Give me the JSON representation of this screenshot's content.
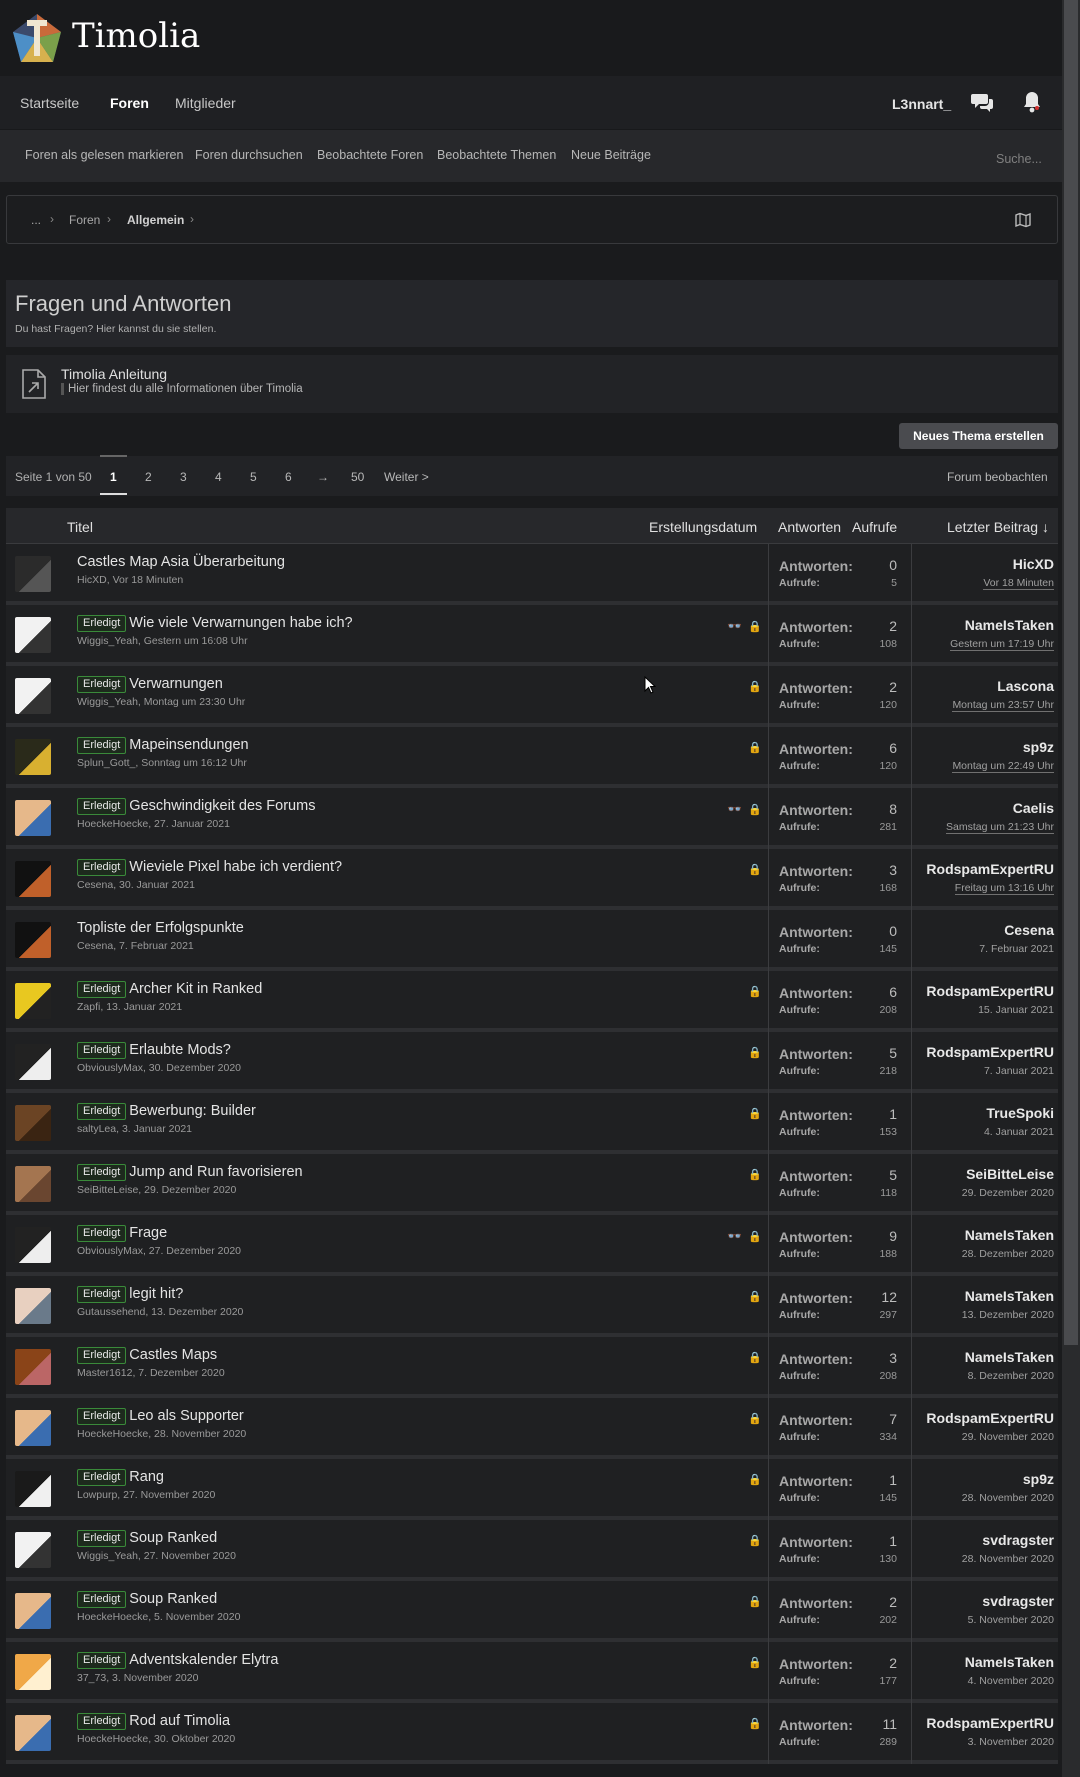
{
  "site": {
    "title": "Timolia"
  },
  "nav": {
    "items": [
      "Startseite",
      "Foren",
      "Mitglieder"
    ],
    "active": "Foren",
    "user": "L3nnart_"
  },
  "subnav": {
    "items": [
      "Foren als gelesen markieren",
      "Foren durchsuchen",
      "Beobachtete Foren",
      "Beobachtete Themen",
      "Neue Beiträge"
    ],
    "search_placeholder": "Suche..."
  },
  "breadcrumb": {
    "items": [
      "...",
      "Foren",
      "Allgemein"
    ],
    "sep": "›"
  },
  "forum": {
    "title": "Fragen und Antworten",
    "description": "Du hast Fragen? Hier kannst du sie stellen."
  },
  "linkbox": {
    "title": "Timolia Anleitung",
    "description": "Hier findest du alle Informationen über Timolia"
  },
  "new_thread_button": "Neues Thema erstellen",
  "pager": {
    "label": "Seite 1 von 50",
    "pages": [
      "1",
      "2",
      "3",
      "4",
      "5",
      "6",
      "→",
      "50"
    ],
    "next": "Weiter >",
    "watch": "Forum beobachten"
  },
  "table": {
    "headers": {
      "title": "Titel",
      "created": "Erstellungsdatum",
      "replies": "Antworten",
      "views": "Aufrufe",
      "last": "Letzter Beitrag ↓"
    },
    "stat_labels": {
      "replies": "Antworten:",
      "views": "Aufrufe:"
    },
    "badge_label": "Erledigt",
    "rows": [
      {
        "title": "Castles Map Asia Überarbeitung",
        "badge": false,
        "author": "HicXD",
        "date": "Vor 18 Minuten",
        "watched": false,
        "locked": false,
        "replies": "0",
        "views": "5",
        "last_user": "HicXD",
        "last_date": "Vor 18 Minuten",
        "avatar": "dark-skin"
      },
      {
        "title": "Wie viele Verwarnungen habe ich?",
        "badge": true,
        "author": "Wiggis_Yeah",
        "date": "Gestern um 16:08 Uhr",
        "watched": true,
        "locked": true,
        "replies": "2",
        "views": "108",
        "last_user": "NameIsTaken",
        "last_date": "Gestern um 17:19 Uhr",
        "avatar": "bw-skin"
      },
      {
        "title": "Verwarnungen",
        "badge": true,
        "author": "Wiggis_Yeah",
        "date": "Montag um 23:30 Uhr",
        "watched": false,
        "locked": true,
        "replies": "2",
        "views": "120",
        "last_user": "Lascona",
        "last_date": "Montag um 23:57 Uhr",
        "avatar": "bw-skin"
      },
      {
        "title": "Mapeinsendungen",
        "badge": true,
        "author": "Splun_Gott_",
        "date": "Sonntag um 16:12 Uhr",
        "watched": false,
        "locked": true,
        "replies": "6",
        "views": "120",
        "last_user": "sp9z",
        "last_date": "Montag um 22:49 Uhr",
        "avatar": "gold-skin"
      },
      {
        "title": "Geschwindigkeit des Forums",
        "badge": true,
        "author": "HoeckeHoecke",
        "date": "27. Januar 2021",
        "watched": true,
        "locked": true,
        "replies": "8",
        "views": "281",
        "last_user": "Caelis",
        "last_date": "Samstag um 21:23 Uhr",
        "avatar": "photo-skin"
      },
      {
        "title": "Wieviele Pixel habe ich verdient?",
        "badge": true,
        "author": "Cesena",
        "date": "30. Januar 2021",
        "watched": false,
        "locked": true,
        "replies": "3",
        "views": "168",
        "last_user": "RodspamExpertRU",
        "last_date": "Freitag um 13:16 Uhr",
        "avatar": "black-skin"
      },
      {
        "title": "Topliste der Erfolgspunkte",
        "badge": false,
        "author": "Cesena",
        "date": "7. Februar 2021",
        "watched": false,
        "locked": false,
        "replies": "0",
        "views": "145",
        "last_user": "Cesena",
        "last_date": "7. Februar 2021",
        "avatar": "black-skin"
      },
      {
        "title": "Archer Kit in Ranked",
        "badge": true,
        "author": "Zapfi",
        "date": "13. Januar 2021",
        "watched": false,
        "locked": true,
        "replies": "6",
        "views": "208",
        "last_user": "RodspamExpertRU",
        "last_date": "15. Januar 2021",
        "avatar": "yellow-skin"
      },
      {
        "title": "Erlaubte Mods?",
        "badge": true,
        "author": "ObviouslyMax",
        "date": "30. Dezember 2020",
        "watched": false,
        "locked": true,
        "replies": "5",
        "views": "218",
        "last_user": "RodspamExpertRU",
        "last_date": "7. Januar 2021",
        "avatar": "black-white-skin"
      },
      {
        "title": "Bewerbung: Builder",
        "badge": true,
        "author": "saltyLea",
        "date": "3. Januar 2021",
        "watched": false,
        "locked": true,
        "replies": "1",
        "views": "153",
        "last_user": "TrueSpoki",
        "last_date": "4. Januar 2021",
        "avatar": "brown-skin"
      },
      {
        "title": "Jump and Run favorisieren",
        "badge": true,
        "author": "SeiBitteLeise",
        "date": "29. Dezember 2020",
        "watched": false,
        "locked": true,
        "replies": "5",
        "views": "118",
        "last_user": "SeiBitteLeise",
        "last_date": "29. Dezember 2020",
        "avatar": "tan-skin"
      },
      {
        "title": "Frage",
        "badge": true,
        "author": "ObviouslyMax",
        "date": "27. Dezember 2020",
        "watched": true,
        "locked": true,
        "replies": "9",
        "views": "188",
        "last_user": "NameIsTaken",
        "last_date": "28. Dezember 2020",
        "avatar": "black-white-skin"
      },
      {
        "title": "legit hit?",
        "badge": true,
        "author": "Gutaussehend",
        "date": "13. Dezember 2020",
        "watched": false,
        "locked": true,
        "replies": "12",
        "views": "297",
        "last_user": "NameIsTaken",
        "last_date": "13. Dezember 2020",
        "avatar": "face-skin"
      },
      {
        "title": "Castles Maps",
        "badge": true,
        "author": "Master1612",
        "date": "7. Dezember 2020",
        "watched": false,
        "locked": true,
        "replies": "3",
        "views": "208",
        "last_user": "NameIsTaken",
        "last_date": "8. Dezember 2020",
        "avatar": "rust-skin"
      },
      {
        "title": "Leo als Supporter",
        "badge": true,
        "author": "HoeckeHoecke",
        "date": "28. November 2020",
        "watched": false,
        "locked": true,
        "replies": "7",
        "views": "334",
        "last_user": "RodspamExpertRU",
        "last_date": "29. November 2020",
        "avatar": "photo-skin"
      },
      {
        "title": "Rang",
        "badge": true,
        "author": "Lowpurp",
        "date": "27. November 2020",
        "watched": false,
        "locked": true,
        "replies": "1",
        "views": "145",
        "last_user": "sp9z",
        "last_date": "28. November 2020",
        "avatar": "panda-skin"
      },
      {
        "title": "Soup Ranked",
        "badge": true,
        "author": "Wiggis_Yeah",
        "date": "27. November 2020",
        "watched": false,
        "locked": true,
        "replies": "1",
        "views": "130",
        "last_user": "svdragster",
        "last_date": "28. November 2020",
        "avatar": "bw-skin"
      },
      {
        "title": "Soup Ranked",
        "badge": true,
        "author": "HoeckeHoecke",
        "date": "5. November 2020",
        "watched": false,
        "locked": true,
        "replies": "2",
        "views": "202",
        "last_user": "svdragster",
        "last_date": "5. November 2020",
        "avatar": "photo-skin"
      },
      {
        "title": "Adventskalender Elytra",
        "badge": true,
        "author": "37_73",
        "date": "3. November 2020",
        "watched": false,
        "locked": true,
        "replies": "2",
        "views": "177",
        "last_user": "NameIsTaken",
        "last_date": "4. November 2020",
        "avatar": "orange-skin"
      },
      {
        "title": "Rod auf Timolia",
        "badge": true,
        "author": "HoeckeHoecke",
        "date": "30. Oktober 2020",
        "watched": false,
        "locked": true,
        "replies": "11",
        "views": "289",
        "last_user": "RodspamExpertRU",
        "last_date": "3. November 2020",
        "avatar": "photo-skin"
      }
    ]
  },
  "colors": {
    "accent_badge": "#3a8a3a",
    "lock": "#d9a536",
    "bg": "#1a1b1d"
  }
}
